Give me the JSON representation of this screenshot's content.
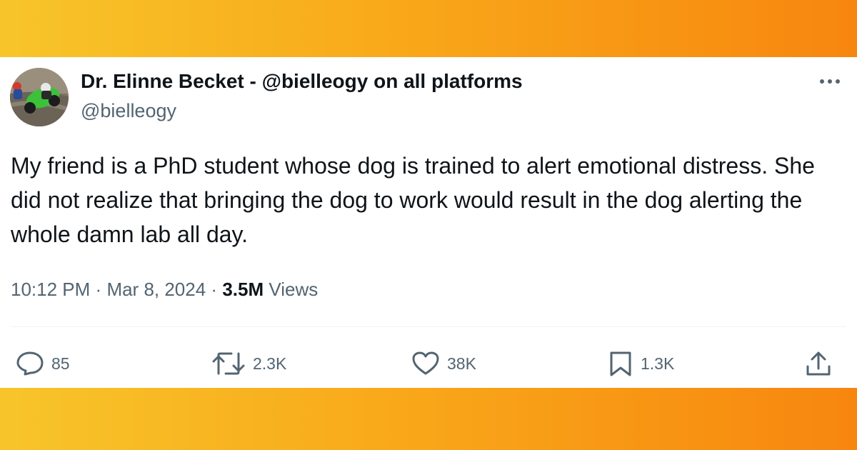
{
  "tweet": {
    "author": {
      "display_name": "Dr. Elinne Becket - @bielleogy on all platforms",
      "handle": "@bielleogy"
    },
    "text": "My friend is a PhD student whose dog is trained to alert emotional distress. She did not realize that bringing the dog to work would result in the dog alerting the whole damn lab all day.",
    "time": "10:12 PM",
    "date": "Mar 8, 2024",
    "views_count": "3.5M",
    "views_label": "Views",
    "separator": "·"
  },
  "actions": {
    "replies": "85",
    "reposts": "2.3K",
    "likes": "38K",
    "bookmarks": "1.3K"
  },
  "icons": {
    "reply": "reply-icon",
    "repost": "repost-icon",
    "like": "heart-icon",
    "bookmark": "bookmark-icon",
    "share": "share-icon",
    "more": "more-icon"
  },
  "colors": {
    "background_gradient_start": "#f7c52a",
    "background_gradient_end": "#f7860f",
    "text_primary": "#0f1419",
    "text_secondary": "#536471"
  }
}
